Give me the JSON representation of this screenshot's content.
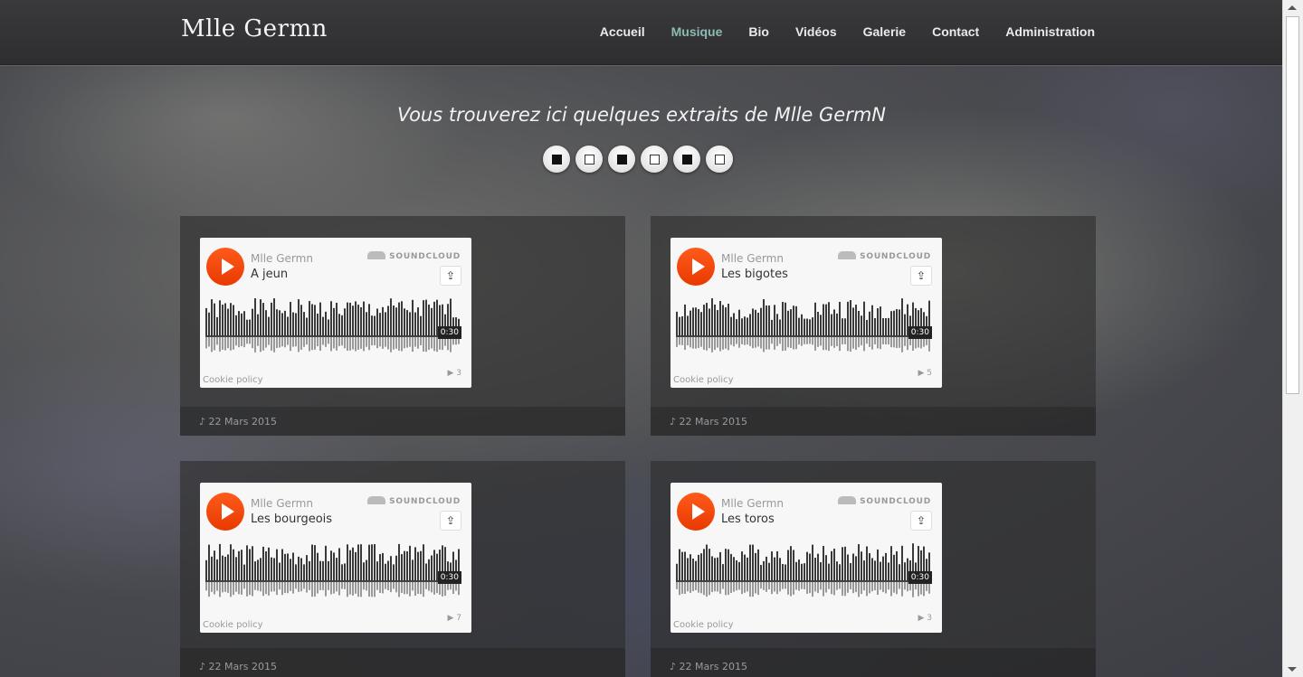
{
  "brand": "Mlle Germn",
  "nav": [
    {
      "label": "Accueil",
      "active": false
    },
    {
      "label": "Musique",
      "active": true
    },
    {
      "label": "Bio",
      "active": false
    },
    {
      "label": "Vidéos",
      "active": false
    },
    {
      "label": "Galerie",
      "active": false
    },
    {
      "label": "Contact",
      "active": false
    },
    {
      "label": "Administration",
      "active": false
    }
  ],
  "intro": "Vous trouverez ici quelques extraits de Mlle GermN",
  "tracks": [
    {
      "artist": "Mlle Germn",
      "title": "A jeun",
      "duration": "0:30",
      "plays": "3",
      "date": "22 Mars 2015",
      "soundcloud": "SOUNDCLOUD",
      "cookie": "Cookie policy"
    },
    {
      "artist": "Mlle Germn",
      "title": "Les bigotes",
      "duration": "0:30",
      "plays": "5",
      "date": "22 Mars 2015",
      "soundcloud": "SOUNDCLOUD",
      "cookie": "Cookie policy"
    },
    {
      "artist": "Mlle Germn",
      "title": "Les bourgeois",
      "duration": "0:30",
      "plays": "7",
      "date": "22 Mars 2015",
      "soundcloud": "SOUNDCLOUD",
      "cookie": "Cookie policy"
    },
    {
      "artist": "Mlle Germn",
      "title": "Les toros",
      "duration": "0:30",
      "plays": "3",
      "date": "22 Mars 2015",
      "soundcloud": "SOUNDCLOUD",
      "cookie": "Cookie policy"
    }
  ],
  "icons": {
    "play": "play-icon",
    "share": "share-icon",
    "note": "music-note-icon",
    "soundcloud": "soundcloud-logo-icon"
  },
  "colors": {
    "accent_nav": "#8dbab2",
    "play_orange": "#ff5500",
    "navbar": "#333333"
  }
}
